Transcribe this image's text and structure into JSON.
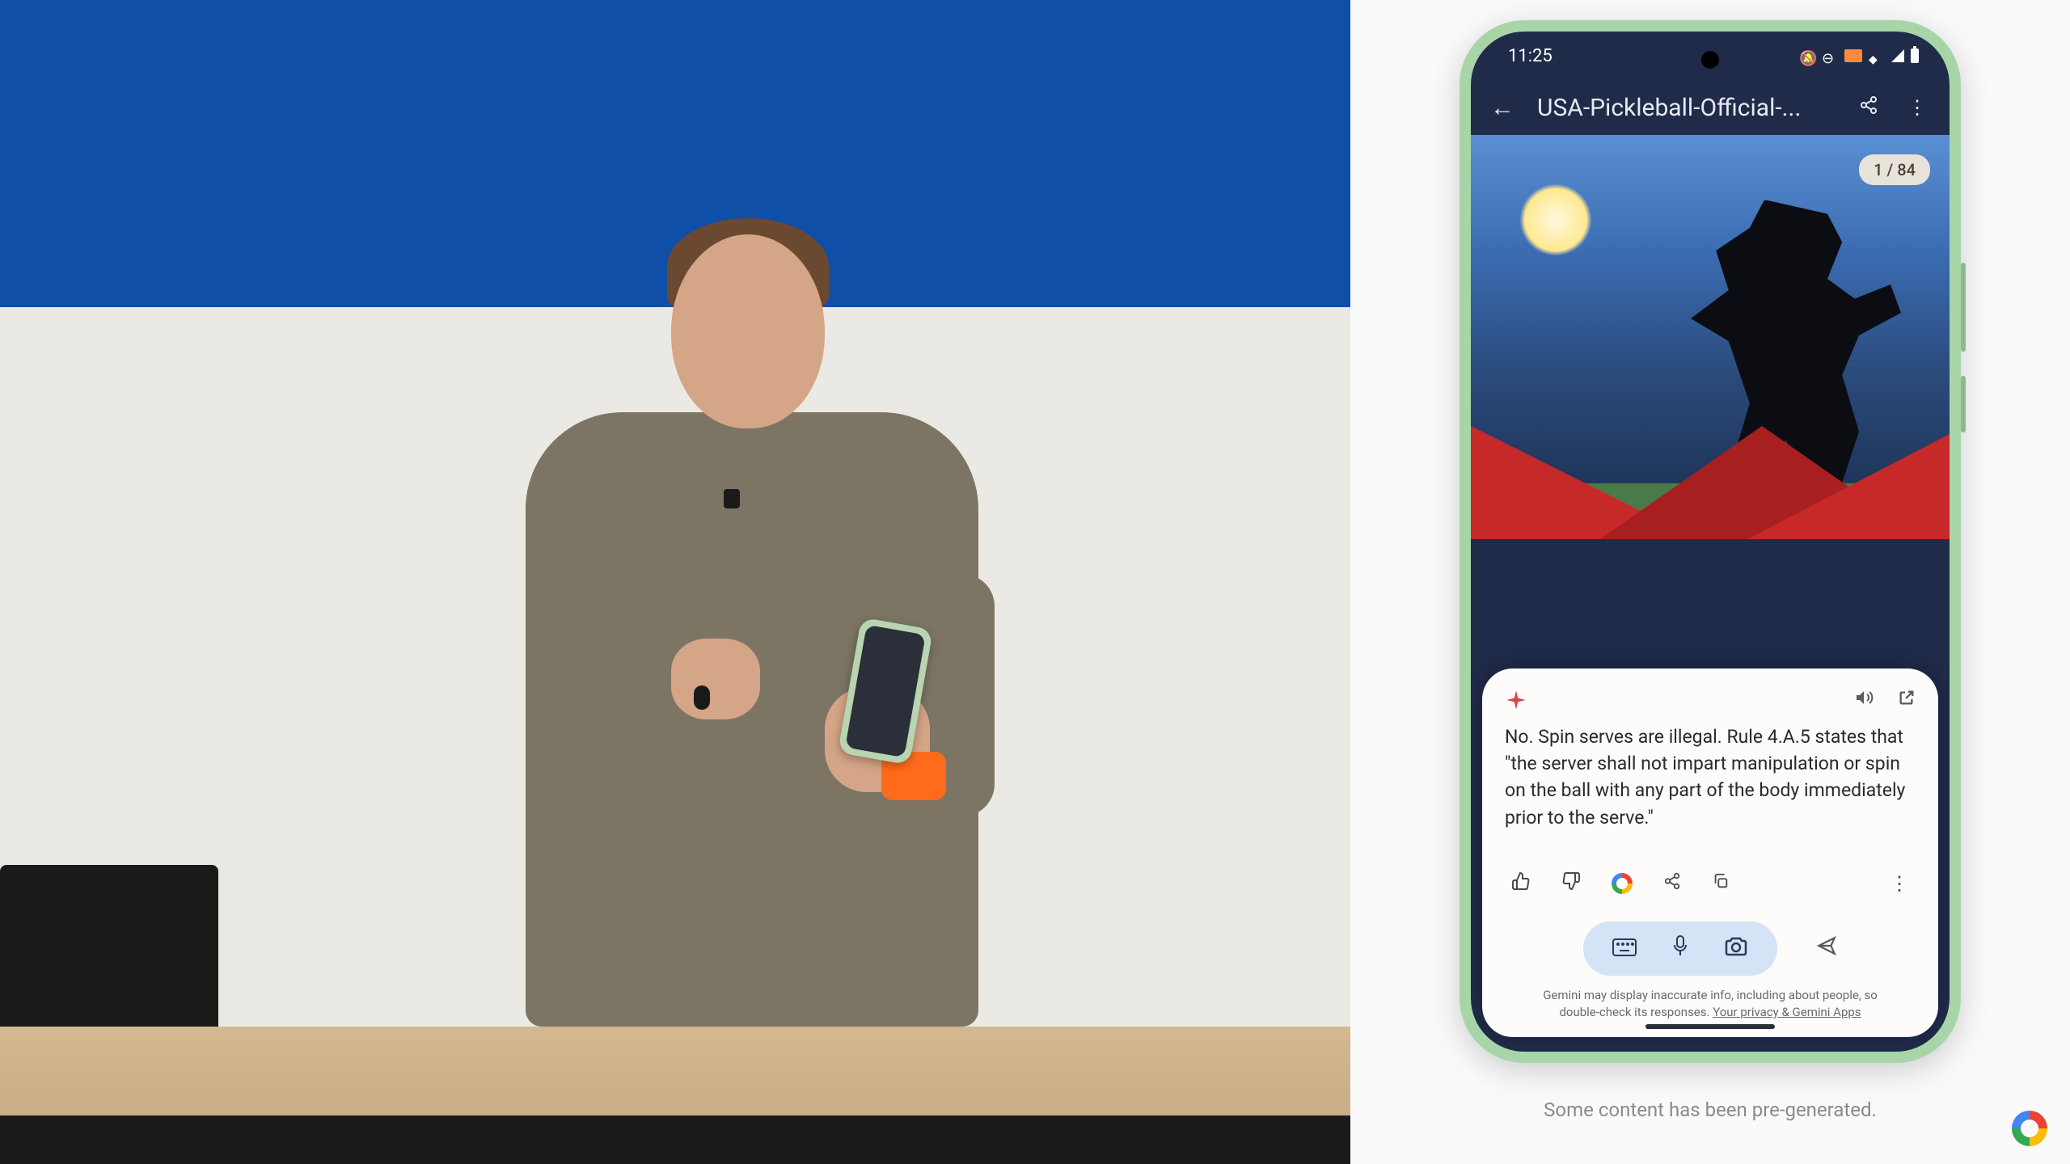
{
  "phone": {
    "status_time": "11:25",
    "header_title": "USA-Pickleball-Official-...",
    "page_badge": "1 / 84",
    "gemini_response": "No. Spin serves are illegal. Rule 4.A.5 states that \"the server shall not impart manipulation or spin on the ball with any part of the body immediately prior to the serve.\"",
    "disclaimer_line1": "Gemini may display inaccurate info, including about people, so",
    "disclaimer_line2": "double-check its responses. ",
    "disclaimer_link": "Your privacy & Gemini Apps"
  },
  "caption": "Some content has been pre-generated."
}
